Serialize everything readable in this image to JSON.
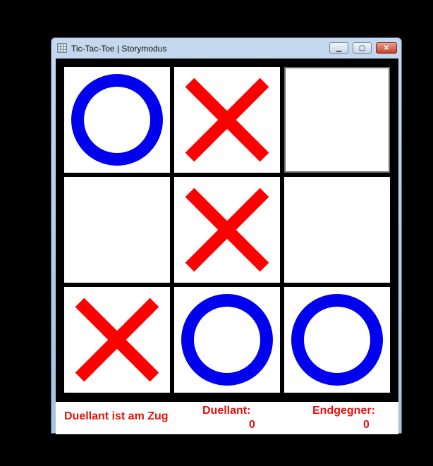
{
  "window": {
    "title": "Tic-Tac-Toe | Storymodus",
    "minimize_icon": "minimize-icon",
    "maximize_icon": "maximize-icon",
    "close_icon": "close-icon"
  },
  "board": {
    "cells": [
      [
        "O",
        "X",
        ""
      ],
      [
        "",
        "X",
        ""
      ],
      [
        "X",
        "O",
        "O"
      ]
    ],
    "highlighted_cell": [
      0,
      2
    ],
    "colors": {
      "x": "#ff0000",
      "o": "#0000ee"
    }
  },
  "status": {
    "turn_text": "Duellant ist am Zug",
    "duellant_label": "Duellant:",
    "duellant_score": "0",
    "endgegner_label": "Endgegner:",
    "endgegner_score": "0",
    "text_color": "#e8100a"
  }
}
